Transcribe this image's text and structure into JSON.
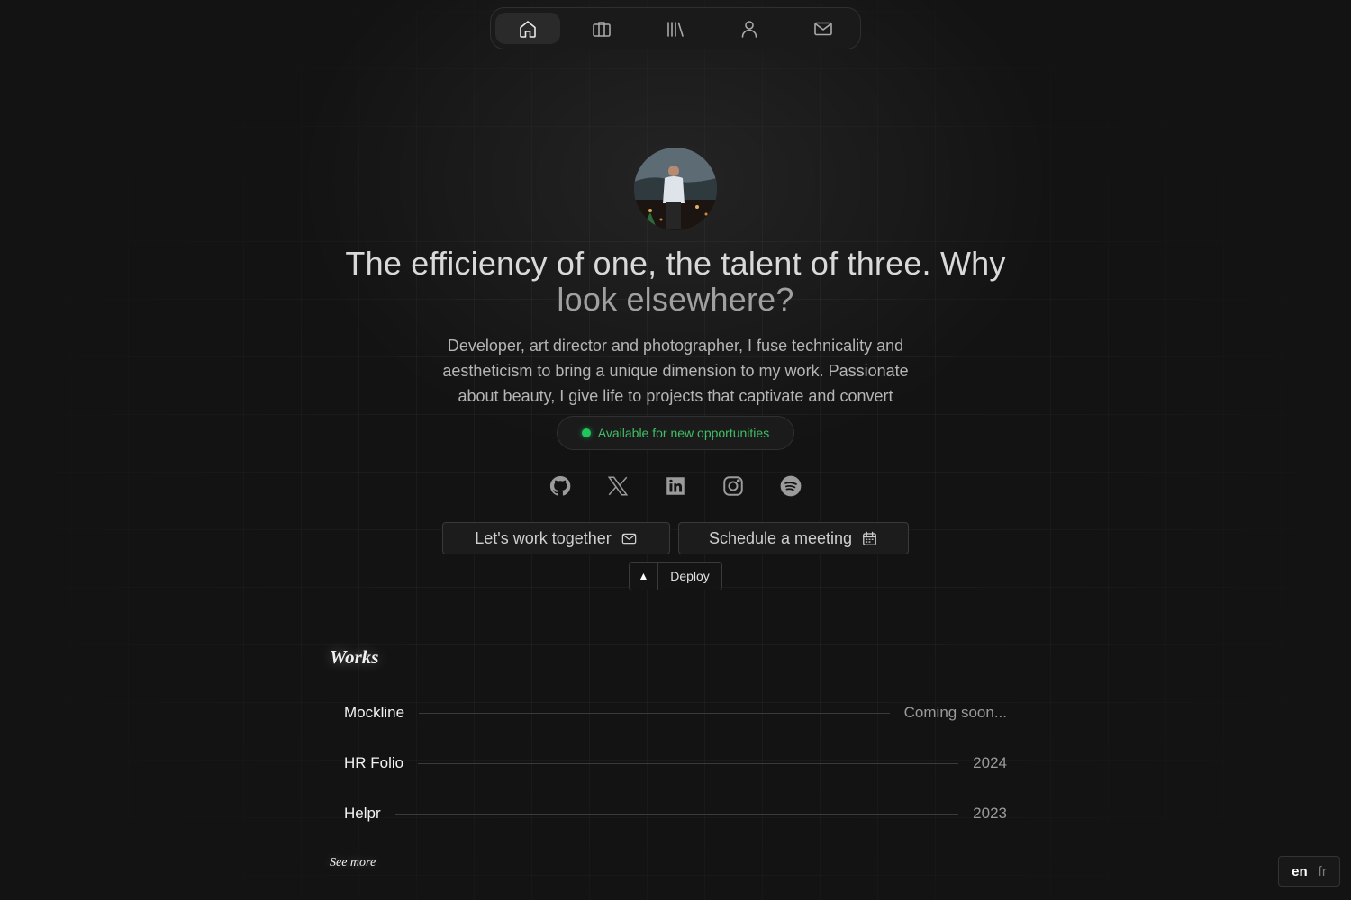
{
  "nav": {
    "items": [
      {
        "icon": "home-icon",
        "active": true
      },
      {
        "icon": "briefcase-icon",
        "active": false
      },
      {
        "icon": "library-icon",
        "active": false
      },
      {
        "icon": "user-icon",
        "active": false
      },
      {
        "icon": "mail-icon",
        "active": false
      }
    ]
  },
  "hero": {
    "headline_main": "The efficiency of one, the talent of three. Why",
    "headline_dim": "look elsewhere?",
    "intro": "Developer, art director and photographer, I fuse technicality and aestheticism to bring a unique dimension to my work. Passionate about beauty, I give life to projects that captivate and convert",
    "status": "Available for new opportunities",
    "status_color": "#22c55e"
  },
  "socials": [
    "github-icon",
    "x-icon",
    "linkedin-icon",
    "instagram-icon",
    "spotify-icon"
  ],
  "cta": {
    "work_together": "Let's work together",
    "schedule": "Schedule a meeting"
  },
  "deploy": {
    "label": "Deploy"
  },
  "works": {
    "title": "Works",
    "items": [
      {
        "name": "Mockline",
        "meta": "Coming soon..."
      },
      {
        "name": "HR Folio",
        "meta": "2024"
      },
      {
        "name": "Helpr",
        "meta": "2023"
      }
    ],
    "see_more": "See more"
  },
  "lang": {
    "current": "en",
    "other": "fr"
  }
}
